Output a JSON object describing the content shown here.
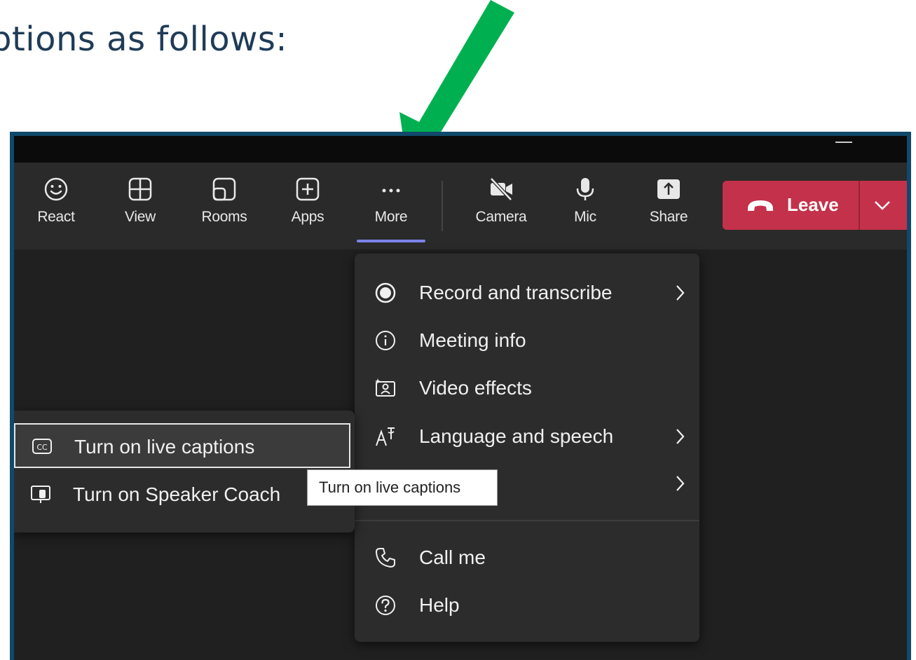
{
  "heading": "ptions as follows:",
  "colors": {
    "arrow": "#00b050",
    "frame_border": "#11496b",
    "leave_button": "#c4314b",
    "more_underline": "#7b83eb"
  },
  "toolbar": {
    "react": "React",
    "view": "View",
    "rooms": "Rooms",
    "apps": "Apps",
    "more": "More",
    "camera": "Camera",
    "mic": "Mic",
    "share": "Share",
    "leave": "Leave"
  },
  "more_menu": {
    "items": [
      {
        "label": "Record and transcribe",
        "icon": "record-icon",
        "submenu": true
      },
      {
        "label": "Meeting info",
        "icon": "info-icon",
        "submenu": false
      },
      {
        "label": "Video effects",
        "icon": "video-effects-icon",
        "submenu": false
      },
      {
        "label": "Language and speech",
        "icon": "language-icon",
        "submenu": true
      },
      {
        "label": "",
        "icon": "",
        "submenu": true
      },
      {
        "label": "Call me",
        "icon": "phone-icon",
        "submenu": false
      },
      {
        "label": "Help",
        "icon": "help-icon",
        "submenu": false
      }
    ]
  },
  "submenu": {
    "items": [
      {
        "label": "Turn on live captions",
        "icon": "captions-icon"
      },
      {
        "label": "Turn on Speaker Coach",
        "icon": "speaker-coach-icon"
      }
    ]
  },
  "tooltip": "Turn on live captions"
}
